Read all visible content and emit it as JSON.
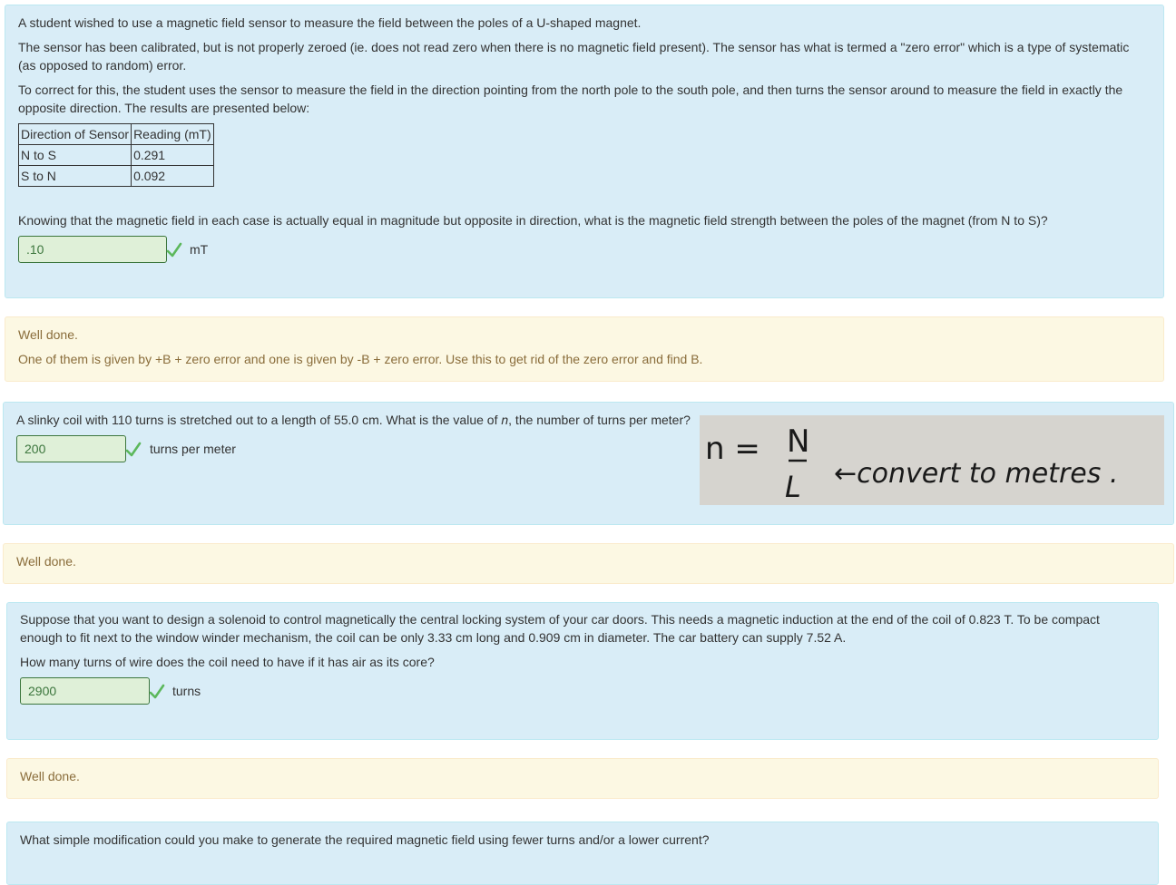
{
  "q1": {
    "para1": "A student wished to use a magnetic field sensor to measure the field between the poles of a U-shaped magnet.",
    "para2": "The sensor has been calibrated, but is not properly zeroed (ie. does not read zero when there is no magnetic field present). The sensor has what is termed a \"zero error\" which is a type of systematic (as opposed to random) error.",
    "para3": "To correct for this, the student uses the sensor to measure the field in the direction pointing from the north pole to the south pole, and then turns the sensor around to measure the field in exactly the opposite direction. The results are presented below:",
    "table": {
      "headers": [
        "Direction of Sensor",
        "Reading (mT)"
      ],
      "rows": [
        [
          "N to S",
          "0.291"
        ],
        [
          "S to N",
          "0.092"
        ]
      ]
    },
    "question": "Knowing that the magnetic field in each case is actually equal in magnitude but opposite in direction, what is the magnetic field strength between the poles of the magnet (from N to S)?",
    "answer": ".10",
    "unit": "mT"
  },
  "fb1": {
    "line1": "Well done.",
    "line2": "One of them is given by +B + zero error and one is given by -B + zero error. Use this to get rid of the zero error and find B."
  },
  "q2": {
    "question_pre": "A slinky coil with 110 turns is stretched out to a length of 55.0 cm. What is the value of ",
    "question_var": "n",
    "question_post": ", the number of turns per meter?",
    "answer": "200",
    "unit": "turns per meter",
    "hint": {
      "lhs": "n =",
      "numerator": "N",
      "denominator": "L",
      "note": "←convert to metres ."
    }
  },
  "fb2": {
    "line1": "Well done."
  },
  "q3": {
    "para1": "Suppose that you want to design a solenoid to control magnetically the central locking system of your car doors. This needs a magnetic induction at the end of the coil of 0.823 T. To be compact enough to fit next to the window winder mechanism, the coil can be only 3.33 cm long and 0.909 cm in diameter. The car battery can supply 7.52 A.",
    "question": "How many turns of wire does the coil need to have if it has air as its core?",
    "answer": "2900",
    "unit": "turns"
  },
  "fb3": {
    "line1": "Well done."
  },
  "q4": {
    "question": "What simple modification could you make to generate the required magnetic field using fewer turns and/or a lower current?"
  },
  "colors": {
    "question_bg": "#d9edf7",
    "feedback_bg": "#fcf8e3",
    "correct_green": "#3c763d",
    "check_green": "#5cb85c"
  },
  "icons": {
    "correct": "check-icon"
  }
}
